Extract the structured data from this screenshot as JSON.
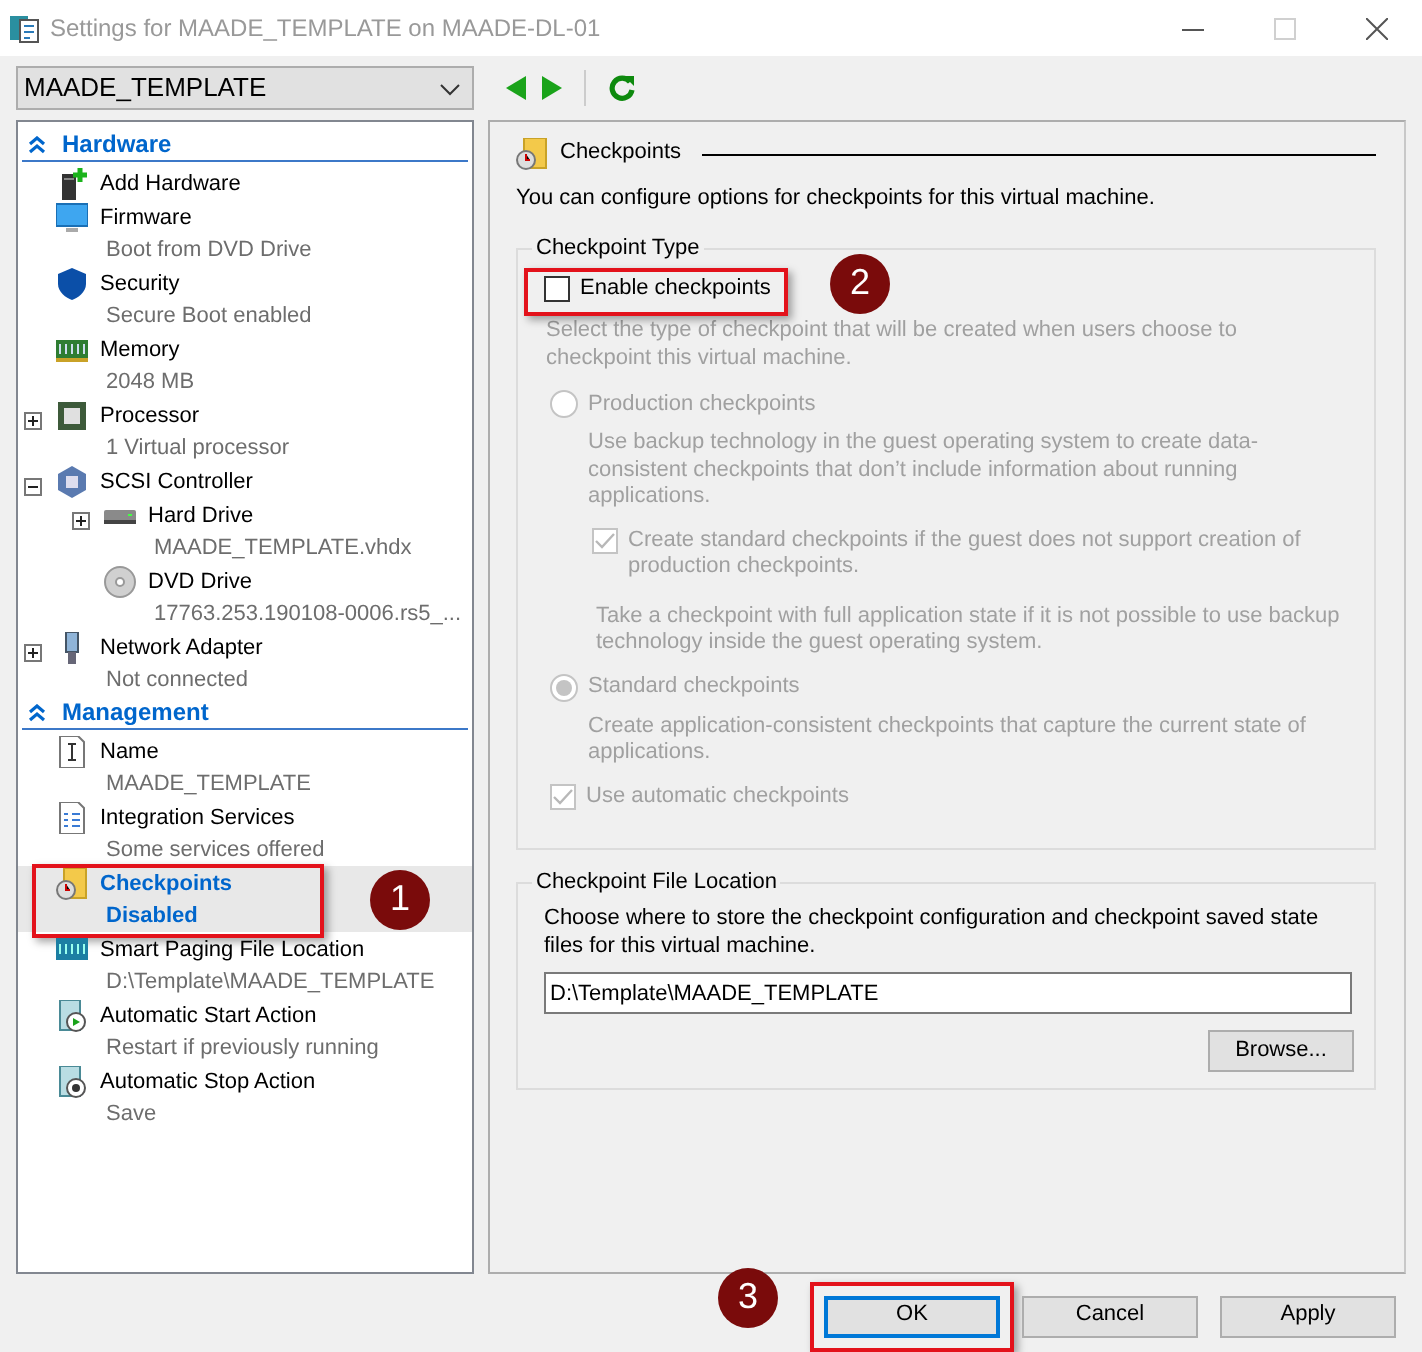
{
  "window": {
    "title": "Settings for MAADE_TEMPLATE on MAADE-DL-01",
    "maximize_disabled": true
  },
  "toolbar": {
    "vm_select": "MAADE_TEMPLATE"
  },
  "sidebar": {
    "sections": [
      {
        "title": "Hardware",
        "expanded": true,
        "items": [
          {
            "title": "Add Hardware",
            "selected": false
          },
          {
            "title": "Firmware",
            "subtitle": "Boot from DVD Drive",
            "selected": false
          },
          {
            "title": "Security",
            "subtitle": "Secure Boot enabled",
            "selected": false
          },
          {
            "title": "Memory",
            "subtitle": "2048 MB",
            "selected": false
          },
          {
            "title": "Processor",
            "subtitle": "1 Virtual processor",
            "expanded": false,
            "selected": false
          },
          {
            "title": "SCSI Controller",
            "expanded": true,
            "selected": false,
            "children": [
              {
                "title": "Hard Drive",
                "subtitle": "MAADE_TEMPLATE.vhdx",
                "expanded": false,
                "selected": false
              },
              {
                "title": "DVD Drive",
                "subtitle": "17763.253.190108-0006.rs5_...",
                "selected": false
              }
            ]
          },
          {
            "title": "Network Adapter",
            "subtitle": "Not connected",
            "expanded": false,
            "selected": false
          }
        ]
      },
      {
        "title": "Management",
        "expanded": true,
        "items": [
          {
            "title": "Name",
            "subtitle": "MAADE_TEMPLATE",
            "selected": false
          },
          {
            "title": "Integration Services",
            "subtitle": "Some services offered",
            "selected": false
          },
          {
            "title": "Checkpoints",
            "subtitle": "Disabled",
            "selected": true,
            "highlighted": true,
            "callout": "1"
          },
          {
            "title": "Smart Paging File Location",
            "subtitle": "D:\\Template\\MAADE_TEMPLATE",
            "selected": false
          },
          {
            "title": "Automatic Start Action",
            "subtitle": "Restart if previously running",
            "selected": false
          },
          {
            "title": "Automatic Stop Action",
            "subtitle": "Save",
            "selected": false
          }
        ]
      }
    ]
  },
  "panel": {
    "title": "Checkpoints",
    "description": "You can configure options for checkpoints for this virtual machine.",
    "checkpoint_type": {
      "legend": "Checkpoint Type",
      "disabled": true,
      "enable": {
        "label": "Enable checkpoints",
        "checked": false,
        "highlighted": true,
        "callout": "2"
      },
      "prompt": "Select the type of checkpoint that will be created when users choose to checkpoint this virtual machine.",
      "options": [
        {
          "kind": "radio",
          "label": "Production checkpoints",
          "selected": false,
          "description": "Use backup technology in the guest operating system to create data-consistent checkpoints that don’t include information about running applications.",
          "children": [
            {
              "kind": "checkbox",
              "label": "Create standard checkpoints if the guest does not support creation of production checkpoints.",
              "checked": true
            },
            {
              "kind": "note",
              "text": "Take a checkpoint with full application state if it is not possible to use backup technology inside the guest operating system."
            }
          ]
        },
        {
          "kind": "radio",
          "label": "Standard checkpoints",
          "selected": true,
          "description": "Create application-consistent checkpoints that capture the current state of applications."
        },
        {
          "kind": "checkbox",
          "label": "Use automatic checkpoints",
          "checked": true
        }
      ]
    },
    "file_location": {
      "legend": "Checkpoint File Location",
      "description": "Choose where to store the checkpoint configuration and checkpoint saved state files for this virtual machine.",
      "path": "D:\\Template\\MAADE_TEMPLATE",
      "browse": "Browse..."
    }
  },
  "buttons": [
    {
      "label": "OK",
      "default": true,
      "highlighted": true,
      "callout": "3"
    },
    {
      "label": "Cancel",
      "default": false
    },
    {
      "label": "Apply",
      "default": false
    }
  ]
}
